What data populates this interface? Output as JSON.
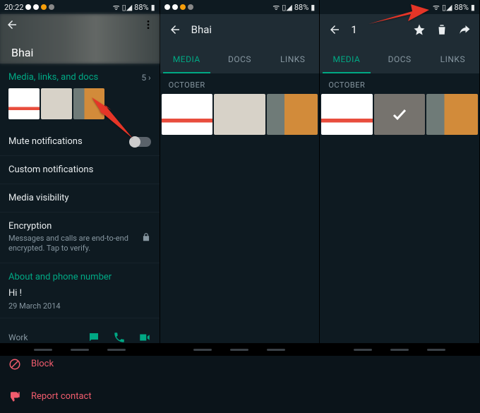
{
  "status": {
    "time": "20:22",
    "battery": "88%"
  },
  "contact_name": "Bhai",
  "screen1": {
    "media_header": "Media, links, and docs",
    "media_count": "5 ›",
    "mute": "Mute notifications",
    "custom": "Custom notifications",
    "visibility": "Media visibility",
    "encryption": "Encryption",
    "encryption_sub": "Messages and calls are end-to-end encrypted. Tap to verify.",
    "about_header": "About and phone number",
    "about_text": "Hi !",
    "about_date": "29 March 2014",
    "work": "Work",
    "block": "Block",
    "report": "Report contact"
  },
  "tabs": {
    "media": "MEDIA",
    "docs": "DOCS",
    "links": "LINKS"
  },
  "month": "OCTOBER",
  "selection_count": "1"
}
